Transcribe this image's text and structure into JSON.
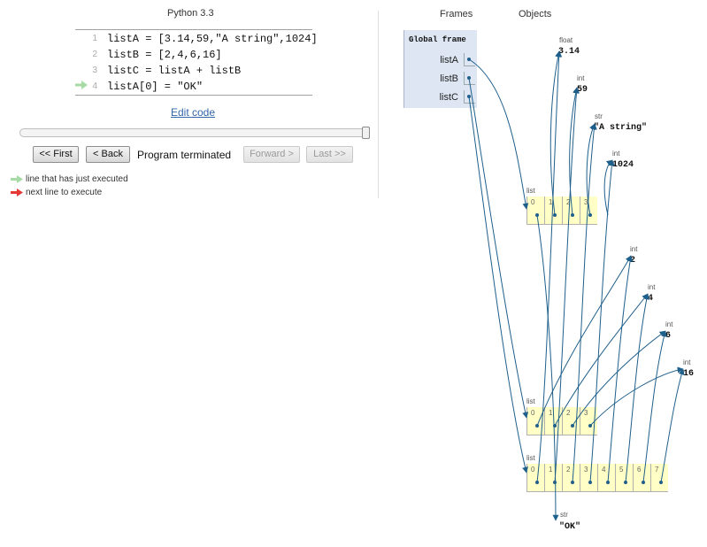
{
  "code_panel": {
    "language": "Python 3.3",
    "lines": [
      {
        "no": "1",
        "text": "listA = [3.14,59,\"A string\",1024]"
      },
      {
        "no": "2",
        "text": "listB = [2,4,6,16]"
      },
      {
        "no": "3",
        "text": "listC = listA + listB"
      },
      {
        "no": "4",
        "text": "listA[0] = \"OK\""
      }
    ],
    "edit_link": "Edit code"
  },
  "navigation": {
    "first": "<< First",
    "back": "< Back",
    "status": "Program terminated",
    "forward": "Forward >",
    "last": "Last >>",
    "step_progress": 1.0
  },
  "legend": {
    "executed": "line that has just executed",
    "next": "next line to execute",
    "executed_color": "#a6dba6",
    "next_color": "#e53935"
  },
  "visualization": {
    "frames_header": "Frames",
    "objects_header": "Objects",
    "global_frame": {
      "title": "Global frame",
      "variables": [
        "listA",
        "listB",
        "listC"
      ]
    },
    "objects": [
      {
        "type": "float",
        "value": "3.14"
      },
      {
        "type": "int",
        "value": "59"
      },
      {
        "type": "str",
        "value": "\"A string\""
      },
      {
        "type": "int",
        "value": "1024"
      },
      {
        "type": "int",
        "value": "2"
      },
      {
        "type": "int",
        "value": "4"
      },
      {
        "type": "int",
        "value": "6"
      },
      {
        "type": "int",
        "value": "16"
      },
      {
        "type": "str",
        "value": "\"OK\""
      }
    ],
    "lists": [
      {
        "type": "list",
        "indices": [
          "0",
          "1",
          "2",
          "3"
        ]
      },
      {
        "type": "list",
        "indices": [
          "0",
          "1",
          "2",
          "3"
        ]
      },
      {
        "type": "list",
        "indices": [
          "0",
          "1",
          "2",
          "3",
          "4",
          "5",
          "6",
          "7"
        ]
      }
    ],
    "arrow_color": "#1f5f8b",
    "cell_color": "#ffffc6",
    "frame_color": "#dde6f2"
  }
}
